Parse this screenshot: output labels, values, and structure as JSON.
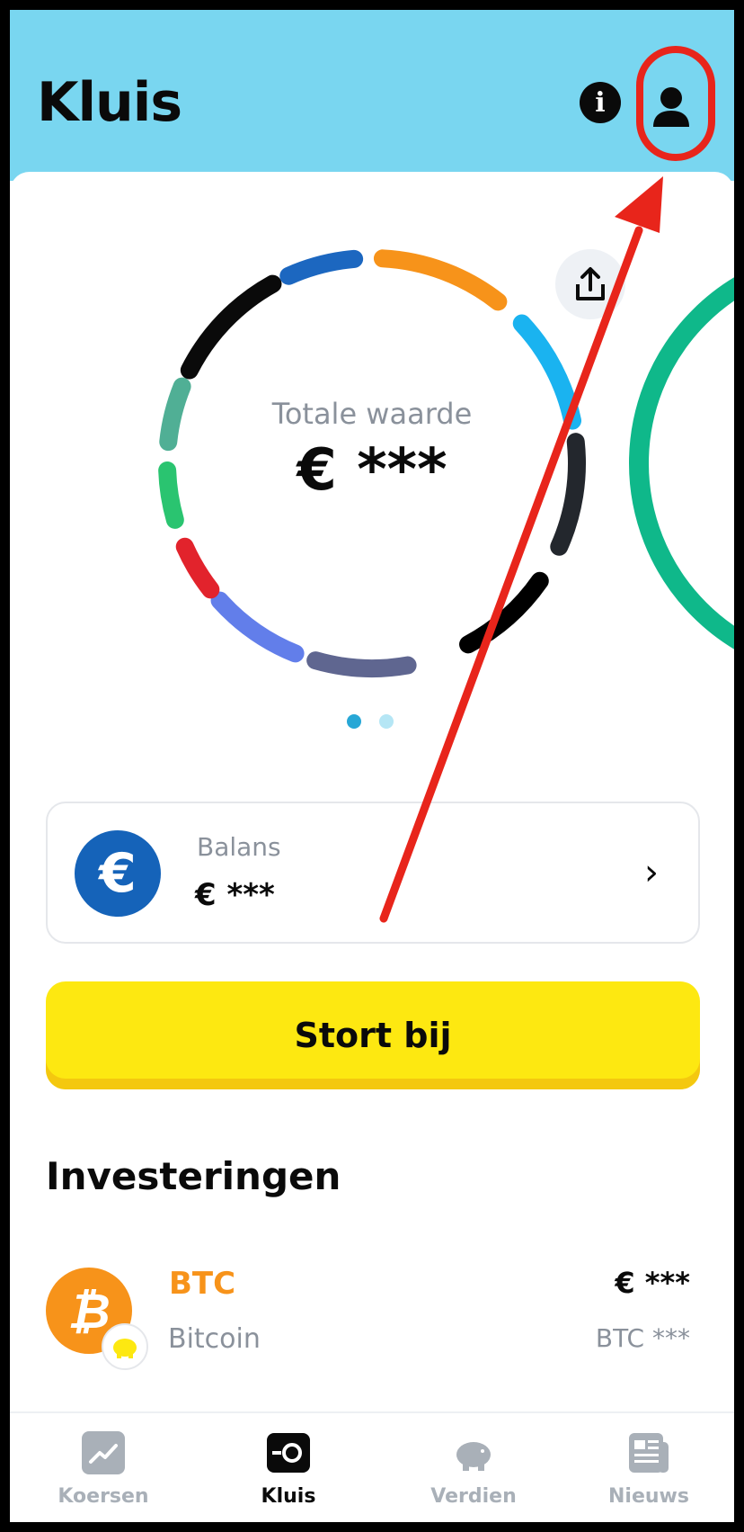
{
  "header": {
    "title": "Kluis"
  },
  "portfolio": {
    "label": "Totale waarde",
    "value": "€ ***",
    "segment_colors": [
      "#f7931a",
      "#1ab3f0",
      "#23272d",
      "#000000",
      "#5f6690",
      "#627eea",
      "#e2232c",
      "#2ac470",
      "#50af95",
      "#0a0a0a",
      "#1c67c0"
    ],
    "page_dots": [
      "#27a7d6",
      "#b5e6f5"
    ]
  },
  "balance": {
    "label": "Balans",
    "value": "€ ***",
    "currency_symbol": "€"
  },
  "deposit_button": {
    "label": "Stort bij"
  },
  "investments": {
    "title": "Investeringen",
    "items": [
      {
        "symbol": "BTC",
        "name": "Bitcoin",
        "value": "€ ***",
        "amount": "BTC ***",
        "color": "#f7931a"
      }
    ]
  },
  "nav": {
    "items": [
      {
        "label": "Koersen",
        "active": false
      },
      {
        "label": "Kluis",
        "active": true
      },
      {
        "label": "Verdien",
        "active": false
      },
      {
        "label": "Nieuws",
        "active": false
      }
    ]
  },
  "annotation_color": "#e8251b"
}
